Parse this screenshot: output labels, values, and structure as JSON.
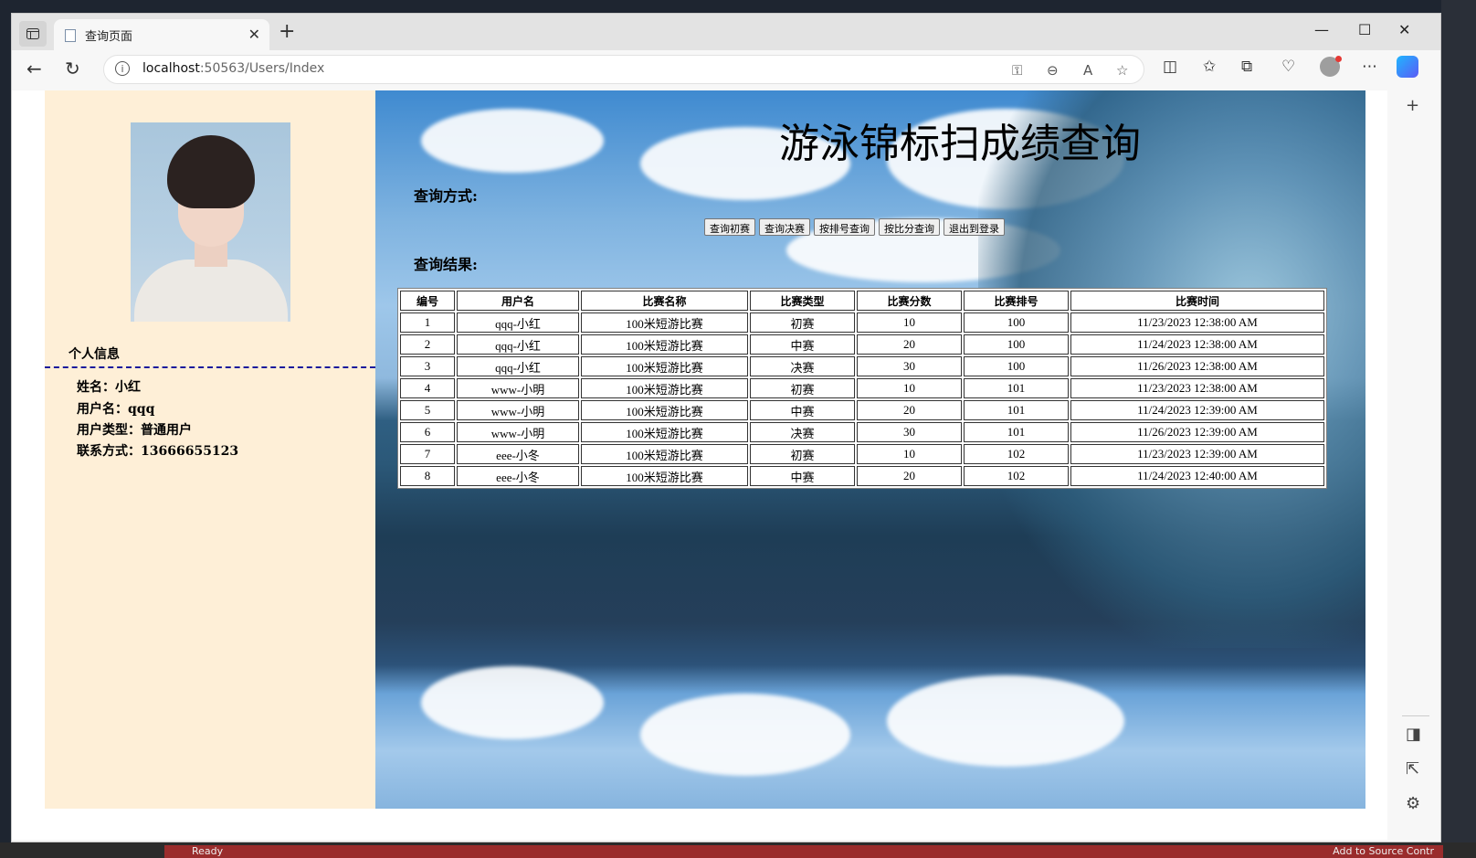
{
  "browser": {
    "tab_title": "查询页面",
    "url_host": "localhost",
    "url_rest": ":50563/Users/Index"
  },
  "taskbar": {
    "status_left": "Ready",
    "status_right": "Add to Source Contr"
  },
  "profile": {
    "section_title": "个人信息",
    "name_line": "姓名：小红",
    "username_line": "用户名：qqq",
    "usertype_line": "用户类型：普通用户",
    "contact_line": "联系方式：13666655123"
  },
  "main": {
    "heading": "游泳锦标扫成绩查询",
    "query_mode_label": "查询方式:",
    "query_result_label": "查询结果:",
    "buttons": [
      "查询初赛",
      "查询决赛",
      "按排号查询",
      "按比分查询",
      "退出到登录"
    ]
  },
  "table": {
    "headers": [
      "编号",
      "用户名",
      "比赛名称",
      "比赛类型",
      "比赛分数",
      "比赛排号",
      "比赛时间"
    ],
    "rows": [
      [
        "1",
        "qqq-小红",
        "100米短游比赛",
        "初赛",
        "10",
        "100",
        "11/23/2023 12:38:00 AM"
      ],
      [
        "2",
        "qqq-小红",
        "100米短游比赛",
        "中赛",
        "20",
        "100",
        "11/24/2023 12:38:00 AM"
      ],
      [
        "3",
        "qqq-小红",
        "100米短游比赛",
        "决赛",
        "30",
        "100",
        "11/26/2023 12:38:00 AM"
      ],
      [
        "4",
        "www-小明",
        "100米短游比赛",
        "初赛",
        "10",
        "101",
        "11/23/2023 12:38:00 AM"
      ],
      [
        "5",
        "www-小明",
        "100米短游比赛",
        "中赛",
        "20",
        "101",
        "11/24/2023 12:39:00 AM"
      ],
      [
        "6",
        "www-小明",
        "100米短游比赛",
        "决赛",
        "30",
        "101",
        "11/26/2023 12:39:00 AM"
      ],
      [
        "7",
        "eee-小冬",
        "100米短游比赛",
        "初赛",
        "10",
        "102",
        "11/23/2023 12:39:00 AM"
      ],
      [
        "8",
        "eee-小冬",
        "100米短游比赛",
        "中赛",
        "20",
        "102",
        "11/24/2023 12:40:00 AM"
      ]
    ]
  },
  "colors": {
    "left_panel_bg": "#feefd7",
    "divider": "#1a1a9c"
  }
}
